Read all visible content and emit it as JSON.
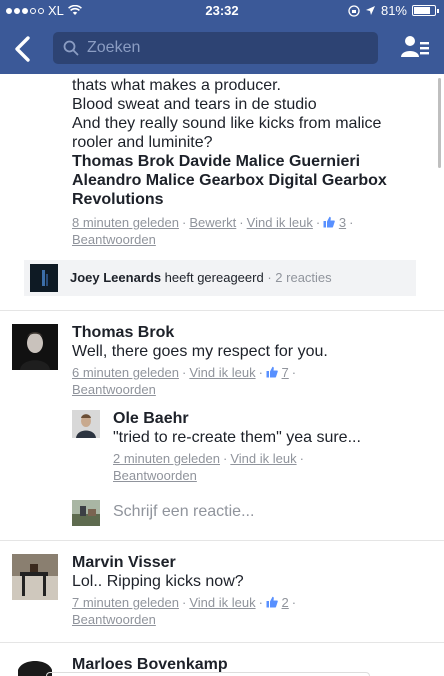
{
  "status": {
    "carrier": "XL",
    "time": "23:32",
    "battery": "81%",
    "battery_level": 0.81
  },
  "search": {
    "placeholder": "Zoeken"
  },
  "post_continuation": {
    "lines": [
      "thats what makes a producer.",
      "Blood sweat and tears in de studio",
      "And they really sound like kicks from  malice",
      "rooler and luminite?"
    ],
    "tags_line1": "Thomas Brok Davide Malice Guernieri",
    "tags_line2": "Aleandro Malice Gearbox Digital Gearbox",
    "tags_line3": "Revolutions",
    "time": "8 minuten geleden",
    "edited": "Bewerkt",
    "like": "Vind ik leuk",
    "like_count": "3",
    "reply": "Beantwoorden"
  },
  "reaction_summary": {
    "name": "Joey Leenards",
    "text": "heeft gereageerd",
    "count": "2 reacties"
  },
  "comments": [
    {
      "name": "Thomas Brok",
      "text": "Well, there goes my respect for you.",
      "time": "6 minuten geleden",
      "like": "Vind ik leuk",
      "like_count": "7",
      "reply": "Beantwoorden",
      "reply_item": {
        "name": "Ole Baehr",
        "text": "\"tried to re-create them\" yea sure...",
        "time": "2 minuten geleden",
        "like": "Vind ik leuk",
        "reply": "Beantwoorden"
      }
    },
    {
      "name": "Marvin Visser",
      "text": "Lol.. Ripping kicks now?",
      "time": "7 minuten geleden",
      "like": "Vind ik leuk",
      "like_count": "2",
      "reply": "Beantwoorden"
    },
    {
      "name": "Marloes Bovenkamp"
    }
  ],
  "write_reply": {
    "placeholder": "Schrijf een reactie..."
  },
  "colors": {
    "brand": "#3b5998",
    "link": "#90949c",
    "text": "#1d2129"
  }
}
